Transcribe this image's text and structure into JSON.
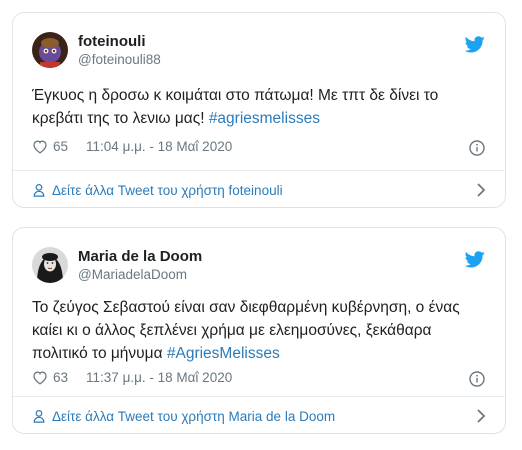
{
  "tweets": [
    {
      "display_name": "foteinouli",
      "handle": "@foteinouli88",
      "text_before": "Έγκυος η δροσω κ κοιμάται στο πάτωμα! Με τπτ δε δίνει το κρεβάτι της το λενιω μας! ",
      "hashtag": "#agriesmelisses",
      "likes": "65",
      "timestamp": "11:04 μ.μ. - 18 Μαΐ 2020",
      "footer_link": "Δείτε άλλα Tweet του χρήστη foteinouli",
      "avatar_icon": "cartoon-character-avatar"
    },
    {
      "display_name": "Maria de la Doom",
      "handle": "@MariadelaDoom",
      "text_before": "Το ζεύγος Σεβαστού είναι σαν διεφθαρμένη κυβέρνηση, ο ένας καίει κι ο άλλος ξεπλένει χρήμα με ελεημοσύνες, ξεκάθαρα πολιτικό το μήνυμα ",
      "hashtag": "#AgriesMelisses",
      "likes": "63",
      "timestamp": "11:37 μ.μ. - 18 Μαΐ 2020",
      "footer_link": "Δείτε άλλα Tweet του χρήστη Maria de la Doom",
      "avatar_icon": "woman-portrait-avatar"
    }
  ],
  "colors": {
    "twitter_blue": "#1da1f2",
    "link_blue": "#2b7bb9",
    "muted_gray": "#697882",
    "border": "#dfe3e7"
  },
  "icons": [
    "twitter-bird-icon",
    "heart-icon",
    "info-icon",
    "person-icon",
    "chevron-right-icon"
  ]
}
